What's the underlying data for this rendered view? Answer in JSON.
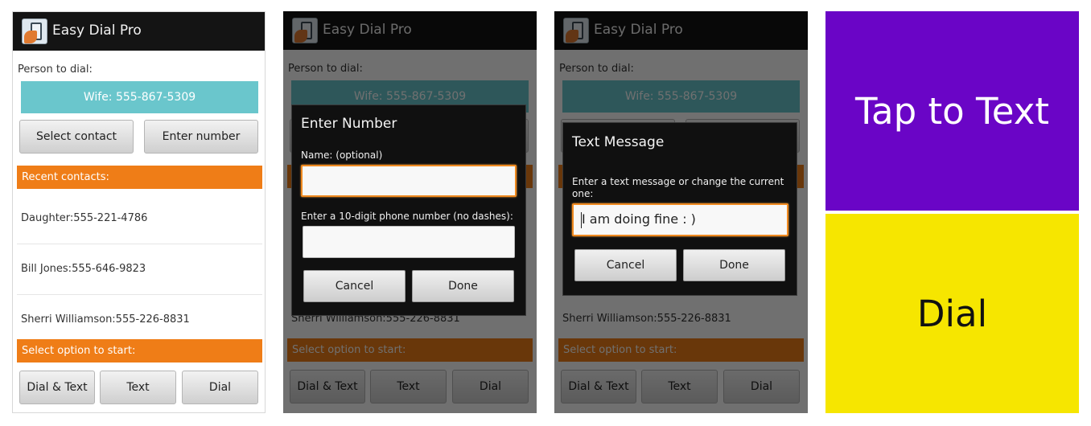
{
  "app": {
    "title": "Easy Dial Pro"
  },
  "main": {
    "person_label": "Person to dial:",
    "selected_person": "Wife: 555-867-5309",
    "select_contact_label": "Select contact",
    "enter_number_label": "Enter number",
    "recent_header": "Recent contacts:",
    "recent_contacts": [
      "Daughter:555-221-4786",
      "Bill Jones:555-646-9823",
      "Sherri Williamson:555-226-8831"
    ],
    "options_header": "Select option to start:",
    "options": [
      "Dial & Text",
      "Text",
      "Dial"
    ]
  },
  "enter_number_dialog": {
    "title": "Enter Number",
    "name_label": "Name: (optional)",
    "name_value": "",
    "phone_label": "Enter a 10-digit phone number (no dashes):",
    "phone_value": "",
    "cancel_label": "Cancel",
    "done_label": "Done"
  },
  "text_message_dialog": {
    "title": "Text Message",
    "prompt": "Enter a text message or change the current one:",
    "message_value": "I am doing fine  :  )",
    "cancel_label": "Cancel",
    "done_label": "Done"
  },
  "action_screen": {
    "tap_to_text_label": "Tap to Text",
    "dial_label": "Dial",
    "colors": {
      "tap_to_text_bg": "#6a05c6",
      "dial_bg": "#f6e600"
    }
  },
  "colors": {
    "accent_orange": "#ef7d17",
    "teal": "#6ac6cc",
    "titlebar": "#141414"
  }
}
